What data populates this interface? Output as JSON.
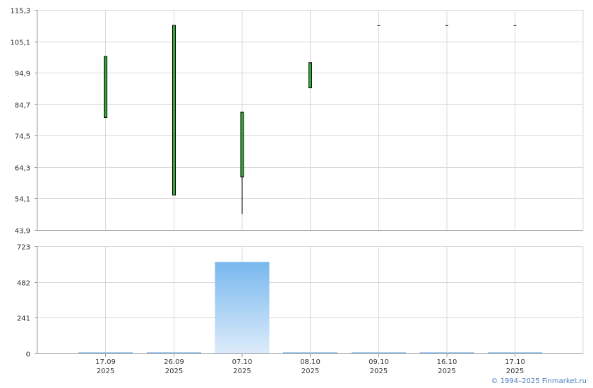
{
  "chart_data": [
    {
      "type": "candlestick",
      "title": "",
      "xlabel": "",
      "ylabel": "",
      "categories": [
        {
          "day": "17.09",
          "year": "2025"
        },
        {
          "day": "26.09",
          "year": "2025"
        },
        {
          "day": "07.10",
          "year": "2025"
        },
        {
          "day": "08.10",
          "year": "2025"
        },
        {
          "day": "09.10",
          "year": "2025"
        },
        {
          "day": "16.10",
          "year": "2025"
        },
        {
          "day": "17.10",
          "year": "2025"
        }
      ],
      "ohlc": [
        {
          "open": 80.4,
          "high": 100.2,
          "low": 80.4,
          "close": 100.2
        },
        {
          "open": 55.2,
          "high": 110.3,
          "low": 55.2,
          "close": 110.3
        },
        {
          "open": 61.1,
          "high": 82.1,
          "low": 49.1,
          "close": 82.1
        },
        {
          "open": 90.0,
          "high": 98.2,
          "low": 90.0,
          "close": 98.2
        },
        {
          "open": 110.2,
          "high": 110.2,
          "low": 110.2,
          "close": 110.2
        },
        {
          "open": 110.2,
          "high": 110.2,
          "low": 110.2,
          "close": 110.2
        },
        {
          "open": 110.2,
          "high": 110.2,
          "low": 110.2,
          "close": 110.2
        }
      ],
      "yticks": [
        "43,9",
        "54,1",
        "64,3",
        "74,5",
        "84,7",
        "94,9",
        "105,1",
        "115,3"
      ],
      "ylim": [
        43.9,
        115.3
      ],
      "grid": true,
      "colors": {
        "up_body": "#33aa33",
        "body_stroke": "#000000",
        "wick": "#000000",
        "grid": "#d8d8d8",
        "axis": "#999999"
      }
    },
    {
      "type": "bar",
      "title": "",
      "xlabel": "",
      "ylabel": "",
      "categories": [
        "17.09 2025",
        "26.09 2025",
        "07.10 2025",
        "08.10 2025",
        "09.10 2025",
        "16.10 2025",
        "17.10 2025"
      ],
      "values": [
        3,
        7,
        617,
        6,
        2,
        2,
        7
      ],
      "yticks": [
        "0",
        "241",
        "482",
        "723"
      ],
      "ylim": [
        0,
        723
      ],
      "grid": true,
      "colors": {
        "bar_top": "#78b8ee",
        "bar_bottom": "#dcebfa",
        "small_bar": "#a8cdee"
      }
    }
  ],
  "footer": {
    "copyright": "© 1994–2025 Finmarket.ru"
  }
}
